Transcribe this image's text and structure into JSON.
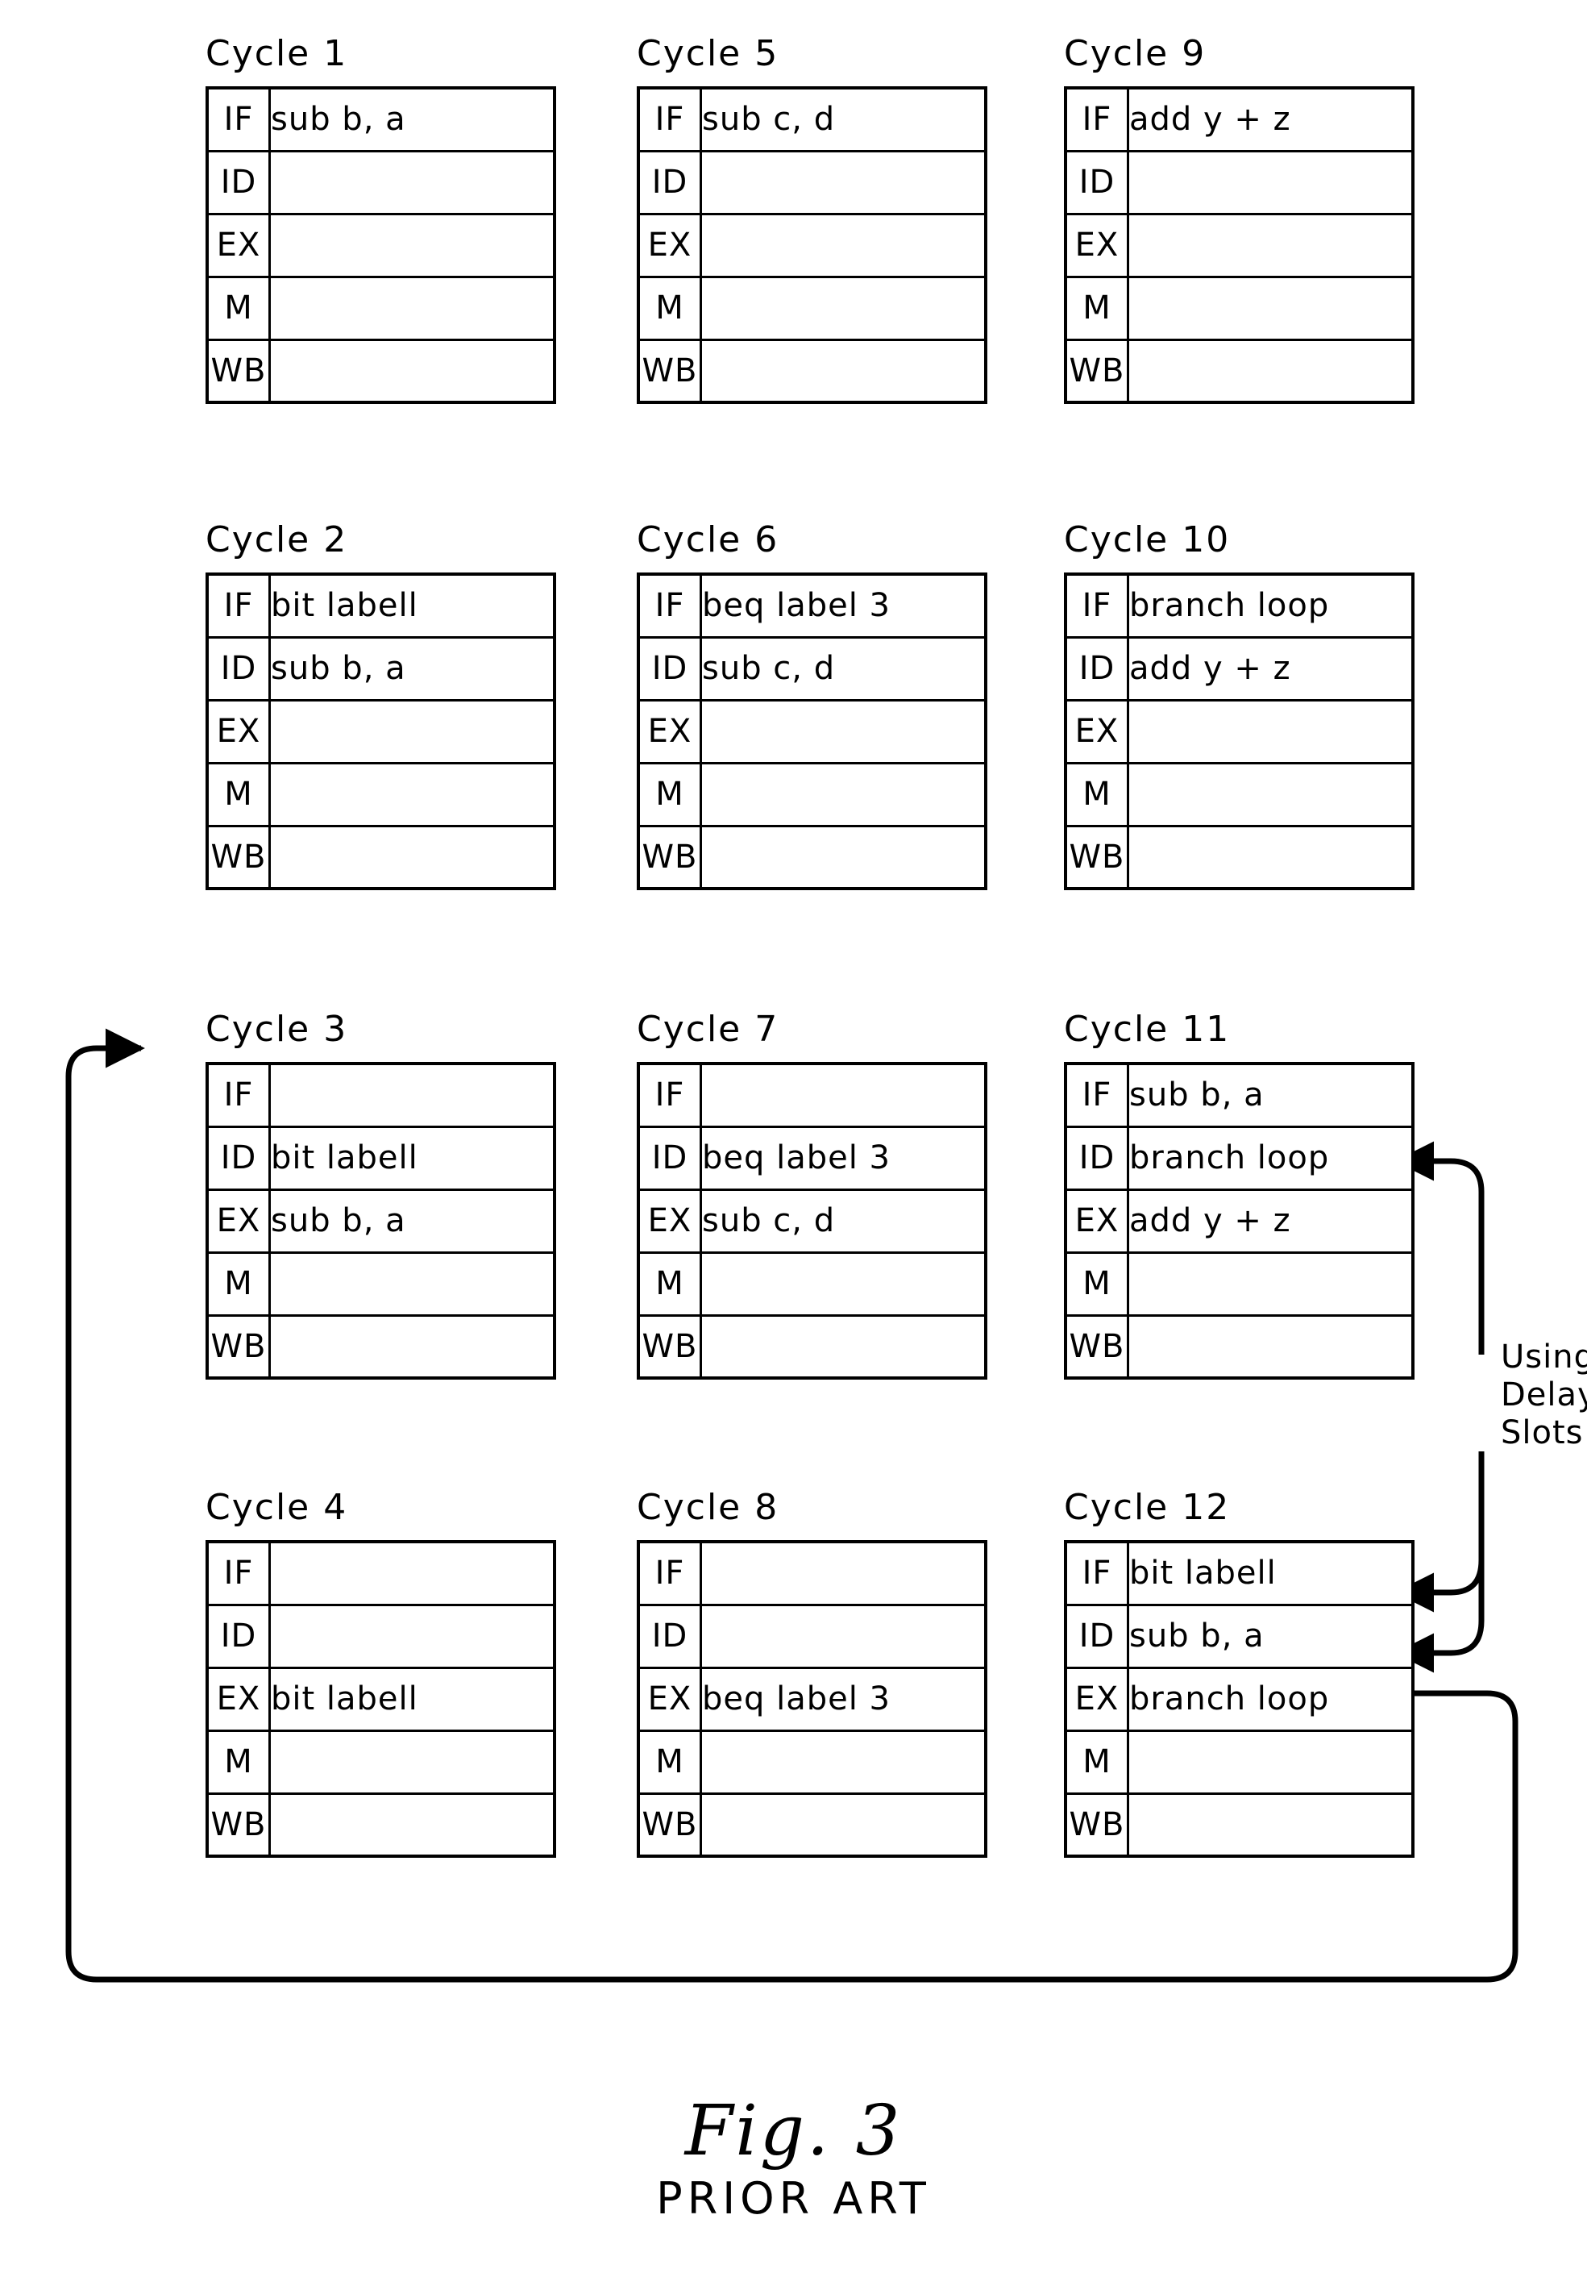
{
  "figure": {
    "label": "Fig. 3",
    "subtitle": "PRIOR ART"
  },
  "stage_labels": [
    "IF",
    "ID",
    "EX",
    "M",
    "WB"
  ],
  "annotations": {
    "delay_slots_line1": "Using",
    "delay_slots_line2": "Delay",
    "delay_slots_line3": "Slots"
  },
  "cycles": [
    {
      "title": "Cycle 1",
      "rows": [
        {
          "stage": "IF",
          "instruction": "sub b, a"
        },
        {
          "stage": "ID",
          "instruction": ""
        },
        {
          "stage": "EX",
          "instruction": ""
        },
        {
          "stage": "M",
          "instruction": ""
        },
        {
          "stage": "WB",
          "instruction": ""
        }
      ]
    },
    {
      "title": "Cycle 5",
      "rows": [
        {
          "stage": "IF",
          "instruction": "sub c, d"
        },
        {
          "stage": "ID",
          "instruction": ""
        },
        {
          "stage": "EX",
          "instruction": ""
        },
        {
          "stage": "M",
          "instruction": ""
        },
        {
          "stage": "WB",
          "instruction": ""
        }
      ]
    },
    {
      "title": "Cycle 9",
      "rows": [
        {
          "stage": "IF",
          "instruction": "add y + z"
        },
        {
          "stage": "ID",
          "instruction": ""
        },
        {
          "stage": "EX",
          "instruction": ""
        },
        {
          "stage": "M",
          "instruction": ""
        },
        {
          "stage": "WB",
          "instruction": ""
        }
      ]
    },
    {
      "title": "Cycle 2",
      "rows": [
        {
          "stage": "IF",
          "instruction": "bit labell"
        },
        {
          "stage": "ID",
          "instruction": "sub b, a"
        },
        {
          "stage": "EX",
          "instruction": ""
        },
        {
          "stage": "M",
          "instruction": ""
        },
        {
          "stage": "WB",
          "instruction": ""
        }
      ]
    },
    {
      "title": "Cycle 6",
      "rows": [
        {
          "stage": "IF",
          "instruction": "beq label 3"
        },
        {
          "stage": "ID",
          "instruction": "sub c, d"
        },
        {
          "stage": "EX",
          "instruction": ""
        },
        {
          "stage": "M",
          "instruction": ""
        },
        {
          "stage": "WB",
          "instruction": ""
        }
      ]
    },
    {
      "title": "Cycle 10",
      "rows": [
        {
          "stage": "IF",
          "instruction": "branch loop"
        },
        {
          "stage": "ID",
          "instruction": "add y + z"
        },
        {
          "stage": "EX",
          "instruction": ""
        },
        {
          "stage": "M",
          "instruction": ""
        },
        {
          "stage": "WB",
          "instruction": ""
        }
      ]
    },
    {
      "title": "Cycle 3",
      "rows": [
        {
          "stage": "IF",
          "instruction": ""
        },
        {
          "stage": "ID",
          "instruction": "bit labell"
        },
        {
          "stage": "EX",
          "instruction": "sub b, a"
        },
        {
          "stage": "M",
          "instruction": ""
        },
        {
          "stage": "WB",
          "instruction": ""
        }
      ]
    },
    {
      "title": "Cycle 7",
      "rows": [
        {
          "stage": "IF",
          "instruction": ""
        },
        {
          "stage": "ID",
          "instruction": "beq label 3"
        },
        {
          "stage": "EX",
          "instruction": "sub c, d"
        },
        {
          "stage": "M",
          "instruction": ""
        },
        {
          "stage": "WB",
          "instruction": ""
        }
      ]
    },
    {
      "title": "Cycle 11",
      "rows": [
        {
          "stage": "IF",
          "instruction": "sub b, a"
        },
        {
          "stage": "ID",
          "instruction": "branch loop"
        },
        {
          "stage": "EX",
          "instruction": "add y + z"
        },
        {
          "stage": "M",
          "instruction": ""
        },
        {
          "stage": "WB",
          "instruction": ""
        }
      ]
    },
    {
      "title": "Cycle 4",
      "rows": [
        {
          "stage": "IF",
          "instruction": ""
        },
        {
          "stage": "ID",
          "instruction": ""
        },
        {
          "stage": "EX",
          "instruction": "bit labell"
        },
        {
          "stage": "M",
          "instruction": ""
        },
        {
          "stage": "WB",
          "instruction": ""
        }
      ]
    },
    {
      "title": "Cycle 8",
      "rows": [
        {
          "stage": "IF",
          "instruction": ""
        },
        {
          "stage": "ID",
          "instruction": ""
        },
        {
          "stage": "EX",
          "instruction": "beq label 3"
        },
        {
          "stage": "M",
          "instruction": ""
        },
        {
          "stage": "WB",
          "instruction": ""
        }
      ]
    },
    {
      "title": "Cycle 12",
      "rows": [
        {
          "stage": "IF",
          "instruction": "bit labell"
        },
        {
          "stage": "ID",
          "instruction": "sub b, a"
        },
        {
          "stage": "EX",
          "instruction": "branch loop"
        },
        {
          "stage": "M",
          "instruction": ""
        },
        {
          "stage": "WB",
          "instruction": ""
        }
      ]
    }
  ]
}
